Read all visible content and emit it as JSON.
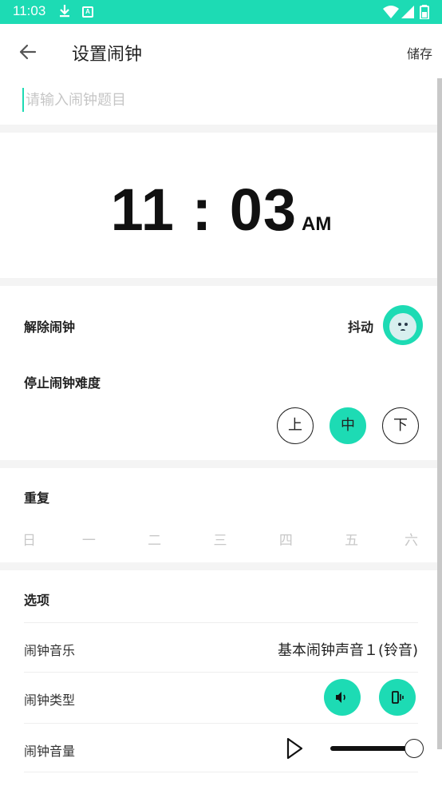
{
  "status_bar": {
    "time": "11:03",
    "notification_badge": "A",
    "icons": [
      "download-icon",
      "wifi-icon",
      "signal-icon",
      "battery-icon"
    ]
  },
  "app_bar": {
    "title": "设置闹钟",
    "save_label": "储存",
    "back_icon": "arrow-left-icon"
  },
  "alarm_title": {
    "value": "",
    "placeholder": "请输入闹钟题目"
  },
  "time": {
    "hour": "11",
    "separator": ":",
    "minute": "03",
    "period": "AM"
  },
  "dismiss": {
    "label": "解除闹钟",
    "method": "抖动",
    "mascot_icon": "shake-mascot-icon"
  },
  "difficulty": {
    "label": "停止闹钟难度",
    "options": [
      "上",
      "中",
      "下"
    ],
    "selected": "中"
  },
  "repeat": {
    "label": "重复",
    "days": [
      "日",
      "一",
      "二",
      "三",
      "四",
      "五",
      "六"
    ]
  },
  "options": {
    "label": "选项",
    "music_label": "闹钟音乐",
    "music_value": "基本闹钟声音１(铃音)",
    "type_label": "闹钟类型",
    "type_icons": [
      "speaker-icon",
      "vibrate-icon"
    ],
    "volume_label": "闹钟音量",
    "volume_level": 1.0
  },
  "colors": {
    "accent": "#1ddbb4",
    "status_bar": "#1ddbb4",
    "text": "#222222",
    "placeholder": "#c6c6c6",
    "day_inactive": "#c8c8c8"
  }
}
